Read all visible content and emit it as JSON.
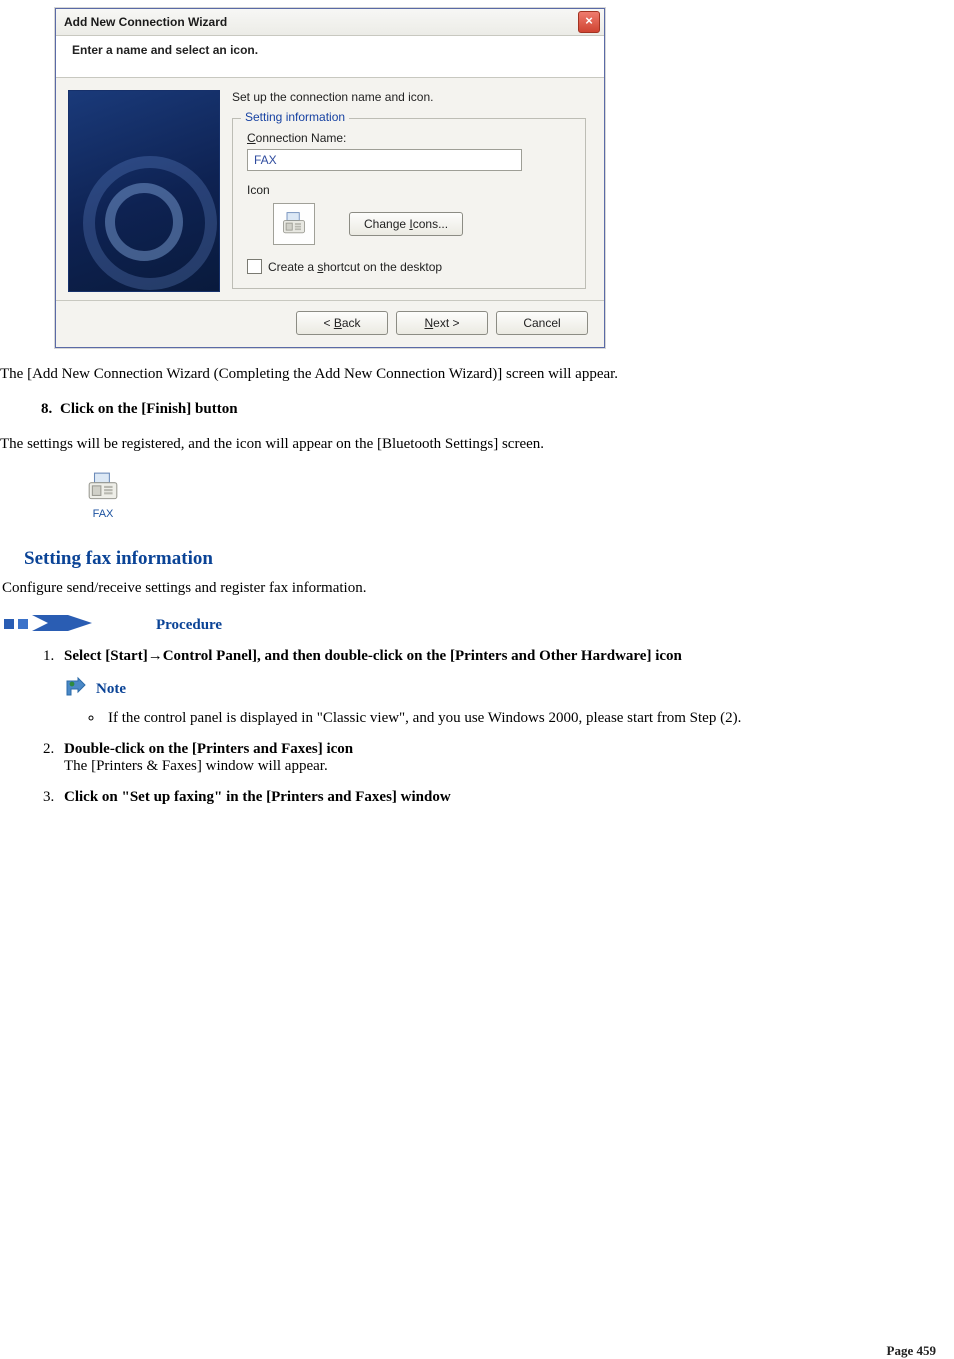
{
  "wizard": {
    "title": "Add New Connection Wizard",
    "subheader": "Enter a name and select an icon.",
    "instruction": "Set up the connection name and icon.",
    "group_legend": "Setting information",
    "conn_name_label": "Connection Name:",
    "conn_name_value": "FAX",
    "icon_label": "Icon",
    "change_icons_label": "Change Icons...",
    "shortcut_label": "Create a shortcut on the desktop",
    "back_label": "< Back",
    "next_label": "Next >",
    "cancel_label": "Cancel"
  },
  "doc": {
    "after_wizard_text": "The [Add New Connection Wizard (Completing the Add New Connection Wizard)] screen will appear.",
    "step8": "Click on the [Finish] button",
    "step8_num": "8.",
    "step8_followup": "The settings will be registered, and the icon will appear on the [Bluetooth Settings] screen.",
    "fax_icon_label": "FAX",
    "section_title": "Setting fax information",
    "section_intro": "Configure send/receive settings and register fax information.",
    "procedure_label": "Procedure",
    "steps": {
      "s1": "Select [Start]→Control Panel], and then double-click on the [Printers and Other Hardware] icon",
      "note_label": "Note",
      "note_text": "If the control panel is displayed in \"Classic view\", and you use Windows 2000, please start from Step (2).",
      "s2_title": "Double-click on the [Printers and Faxes] icon",
      "s2_body": "The [Printers & Faxes] window will appear.",
      "s3": "Click on \"Set up faxing\" in the [Printers and Faxes] window"
    },
    "page_label": "Page",
    "page_number": "459"
  }
}
